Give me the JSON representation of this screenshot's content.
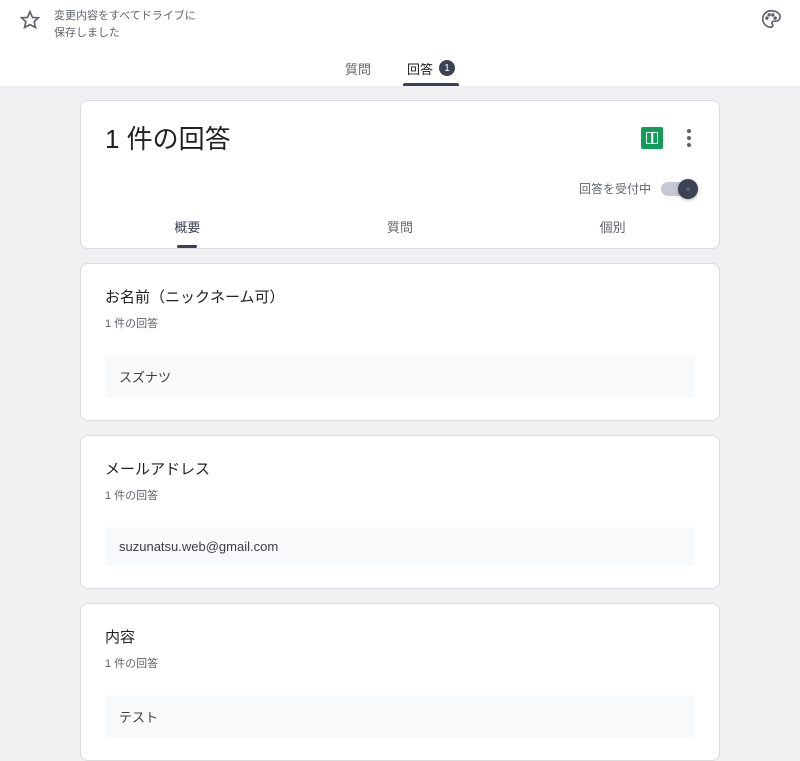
{
  "topbar": {
    "save_status_line1": "変更内容をすべてドライブに",
    "save_status_line2": "保存しました"
  },
  "main_tabs": {
    "questions": "質問",
    "responses": "回答",
    "responses_badge": "1"
  },
  "header_card": {
    "title": "1 件の回答",
    "accepting_label": "回答を受付中"
  },
  "sub_tabs": {
    "summary": "概要",
    "question": "質問",
    "individual": "個別"
  },
  "questions": [
    {
      "title": "お名前（ニックネーム可）",
      "count": "1 件の回答",
      "answer": "スズナツ"
    },
    {
      "title": "メールアドレス",
      "count": "1 件の回答",
      "answer": "suzunatsu.web@gmail.com"
    },
    {
      "title": "内容",
      "count": "1 件の回答",
      "answer": "テスト"
    }
  ]
}
